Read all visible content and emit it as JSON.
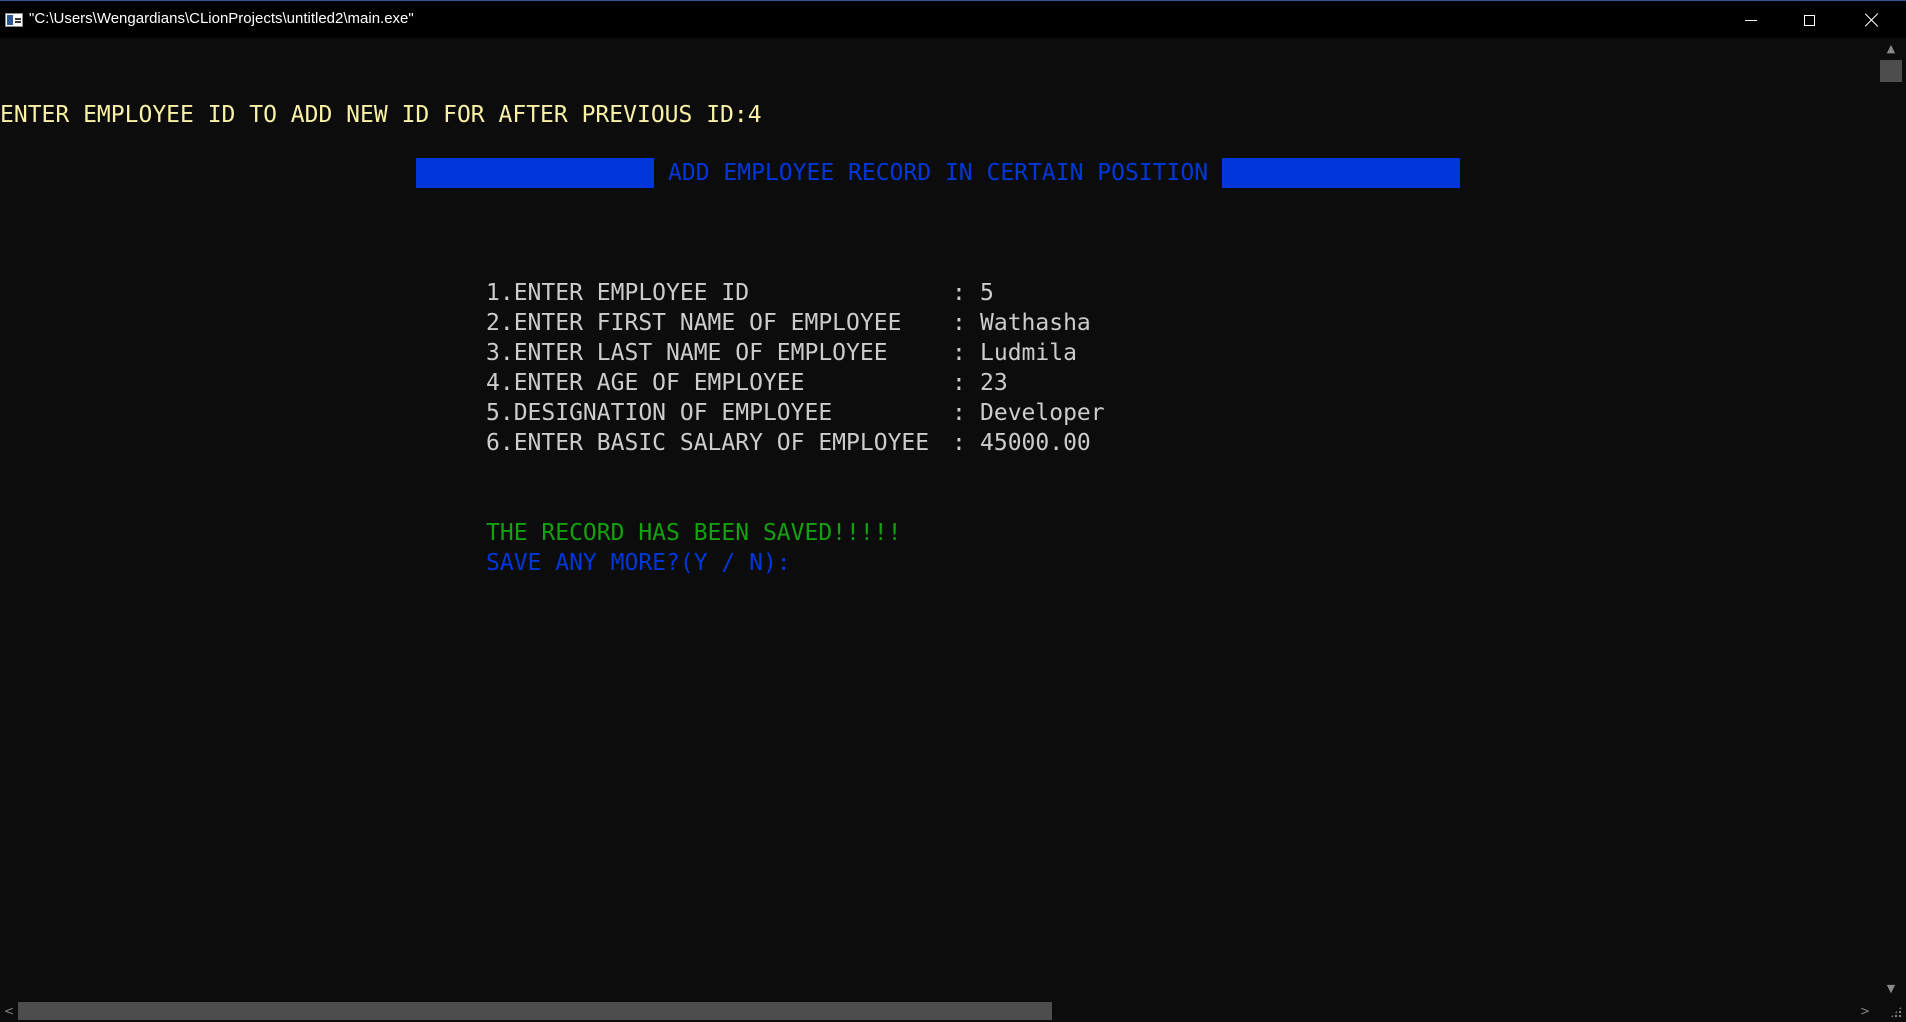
{
  "window": {
    "title": "\"C:\\Users\\Wengardians\\CLionProjects\\untitled2\\main.exe\"",
    "controls": {
      "minimize_icon": "minimize-icon",
      "maximize_icon": "maximize-icon",
      "close_icon": "close-icon"
    }
  },
  "console": {
    "prompt": "ENTER EMPLOYEE ID TO ADD NEW ID FOR AFTER PREVIOUS ID:4",
    "banner_title": "ADD EMPLOYEE RECORD IN CERTAIN POSITION",
    "form": [
      {
        "label": "1.ENTER EMPLOYEE ID",
        "sep": ":",
        "value": "5"
      },
      {
        "label": "2.ENTER FIRST NAME OF EMPLOYEE",
        "sep": ":",
        "value": "Wathasha"
      },
      {
        "label": "3.ENTER LAST NAME OF EMPLOYEE",
        "sep": ":",
        "value": "Ludmila"
      },
      {
        "label": "4.ENTER AGE OF EMPLOYEE",
        "sep": ":",
        "value": "23"
      },
      {
        "label": "5.DESIGNATION OF EMPLOYEE",
        "sep": ":",
        "value": "Developer"
      },
      {
        "label": "6.ENTER BASIC SALARY OF EMPLOYEE",
        "sep": ":",
        "value": "45000.00"
      }
    ],
    "saved_message": "THE RECORD HAS BEEN SAVED!!!!!",
    "save_more_prompt": "SAVE ANY MORE?(Y / N):"
  },
  "colors": {
    "background": "#0c0c0c",
    "prompt_yellow": "#f9f1a5",
    "banner_blue": "#0037da",
    "success_green": "#13a10e",
    "text_gray": "#cccccc"
  }
}
